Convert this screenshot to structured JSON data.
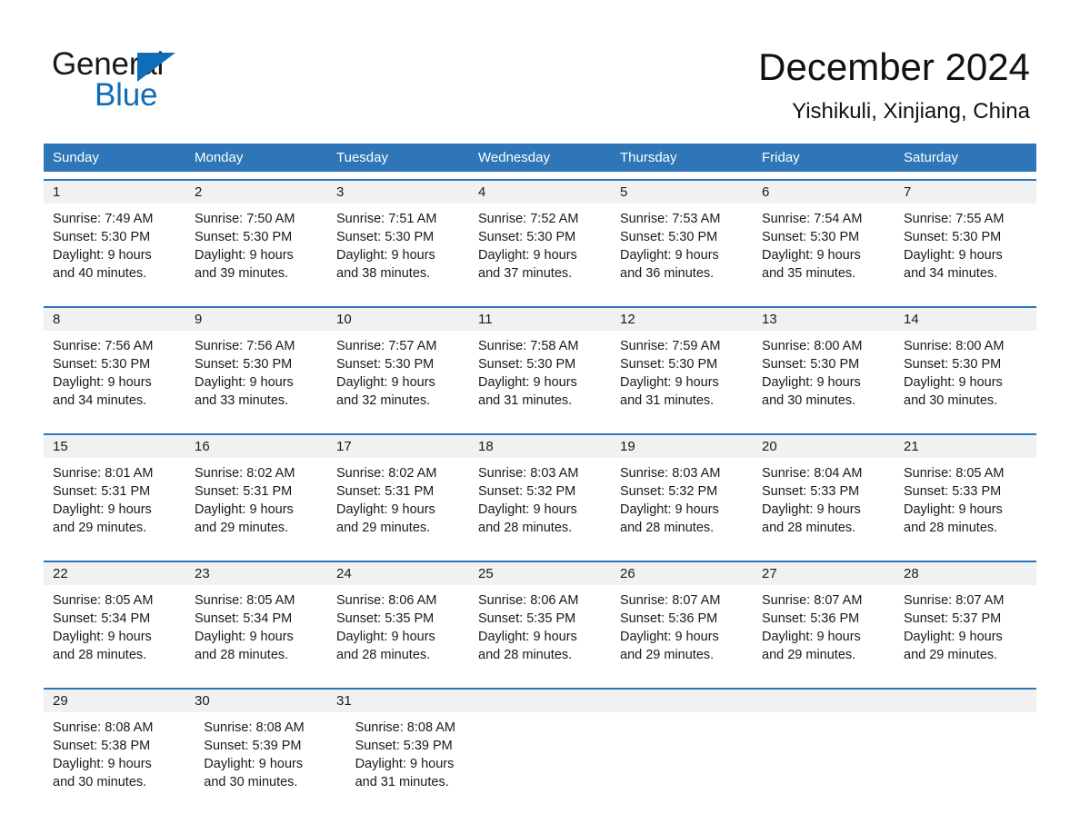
{
  "brand": {
    "name_part1": "General",
    "name_part2": "Blue",
    "triangle_icon": "triangle-icon",
    "accent_color": "#0f6cb6"
  },
  "header": {
    "title": "December 2024",
    "location": "Yishikuli, Xinjiang, China"
  },
  "colors": {
    "header_blue": "#2e76b8",
    "daynum_band": "#f1f1f1",
    "text": "#1a1a1a"
  },
  "weekdays": [
    "Sunday",
    "Monday",
    "Tuesday",
    "Wednesday",
    "Thursday",
    "Friday",
    "Saturday"
  ],
  "weeks": [
    {
      "days": [
        {
          "num": "1",
          "sunrise": "Sunrise: 7:49 AM",
          "sunset": "Sunset: 5:30 PM",
          "daylight1": "Daylight: 9 hours",
          "daylight2": "and 40 minutes."
        },
        {
          "num": "2",
          "sunrise": "Sunrise: 7:50 AM",
          "sunset": "Sunset: 5:30 PM",
          "daylight1": "Daylight: 9 hours",
          "daylight2": "and 39 minutes."
        },
        {
          "num": "3",
          "sunrise": "Sunrise: 7:51 AM",
          "sunset": "Sunset: 5:30 PM",
          "daylight1": "Daylight: 9 hours",
          "daylight2": "and 38 minutes."
        },
        {
          "num": "4",
          "sunrise": "Sunrise: 7:52 AM",
          "sunset": "Sunset: 5:30 PM",
          "daylight1": "Daylight: 9 hours",
          "daylight2": "and 37 minutes."
        },
        {
          "num": "5",
          "sunrise": "Sunrise: 7:53 AM",
          "sunset": "Sunset: 5:30 PM",
          "daylight1": "Daylight: 9 hours",
          "daylight2": "and 36 minutes."
        },
        {
          "num": "6",
          "sunrise": "Sunrise: 7:54 AM",
          "sunset": "Sunset: 5:30 PM",
          "daylight1": "Daylight: 9 hours",
          "daylight2": "and 35 minutes."
        },
        {
          "num": "7",
          "sunrise": "Sunrise: 7:55 AM",
          "sunset": "Sunset: 5:30 PM",
          "daylight1": "Daylight: 9 hours",
          "daylight2": "and 34 minutes."
        }
      ]
    },
    {
      "days": [
        {
          "num": "8",
          "sunrise": "Sunrise: 7:56 AM",
          "sunset": "Sunset: 5:30 PM",
          "daylight1": "Daylight: 9 hours",
          "daylight2": "and 34 minutes."
        },
        {
          "num": "9",
          "sunrise": "Sunrise: 7:56 AM",
          "sunset": "Sunset: 5:30 PM",
          "daylight1": "Daylight: 9 hours",
          "daylight2": "and 33 minutes."
        },
        {
          "num": "10",
          "sunrise": "Sunrise: 7:57 AM",
          "sunset": "Sunset: 5:30 PM",
          "daylight1": "Daylight: 9 hours",
          "daylight2": "and 32 minutes."
        },
        {
          "num": "11",
          "sunrise": "Sunrise: 7:58 AM",
          "sunset": "Sunset: 5:30 PM",
          "daylight1": "Daylight: 9 hours",
          "daylight2": "and 31 minutes."
        },
        {
          "num": "12",
          "sunrise": "Sunrise: 7:59 AM",
          "sunset": "Sunset: 5:30 PM",
          "daylight1": "Daylight: 9 hours",
          "daylight2": "and 31 minutes."
        },
        {
          "num": "13",
          "sunrise": "Sunrise: 8:00 AM",
          "sunset": "Sunset: 5:30 PM",
          "daylight1": "Daylight: 9 hours",
          "daylight2": "and 30 minutes."
        },
        {
          "num": "14",
          "sunrise": "Sunrise: 8:00 AM",
          "sunset": "Sunset: 5:30 PM",
          "daylight1": "Daylight: 9 hours",
          "daylight2": "and 30 minutes."
        }
      ]
    },
    {
      "days": [
        {
          "num": "15",
          "sunrise": "Sunrise: 8:01 AM",
          "sunset": "Sunset: 5:31 PM",
          "daylight1": "Daylight: 9 hours",
          "daylight2": "and 29 minutes."
        },
        {
          "num": "16",
          "sunrise": "Sunrise: 8:02 AM",
          "sunset": "Sunset: 5:31 PM",
          "daylight1": "Daylight: 9 hours",
          "daylight2": "and 29 minutes."
        },
        {
          "num": "17",
          "sunrise": "Sunrise: 8:02 AM",
          "sunset": "Sunset: 5:31 PM",
          "daylight1": "Daylight: 9 hours",
          "daylight2": "and 29 minutes."
        },
        {
          "num": "18",
          "sunrise": "Sunrise: 8:03 AM",
          "sunset": "Sunset: 5:32 PM",
          "daylight1": "Daylight: 9 hours",
          "daylight2": "and 28 minutes."
        },
        {
          "num": "19",
          "sunrise": "Sunrise: 8:03 AM",
          "sunset": "Sunset: 5:32 PM",
          "daylight1": "Daylight: 9 hours",
          "daylight2": "and 28 minutes."
        },
        {
          "num": "20",
          "sunrise": "Sunrise: 8:04 AM",
          "sunset": "Sunset: 5:33 PM",
          "daylight1": "Daylight: 9 hours",
          "daylight2": "and 28 minutes."
        },
        {
          "num": "21",
          "sunrise": "Sunrise: 8:05 AM",
          "sunset": "Sunset: 5:33 PM",
          "daylight1": "Daylight: 9 hours",
          "daylight2": "and 28 minutes."
        }
      ]
    },
    {
      "days": [
        {
          "num": "22",
          "sunrise": "Sunrise: 8:05 AM",
          "sunset": "Sunset: 5:34 PM",
          "daylight1": "Daylight: 9 hours",
          "daylight2": "and 28 minutes."
        },
        {
          "num": "23",
          "sunrise": "Sunrise: 8:05 AM",
          "sunset": "Sunset: 5:34 PM",
          "daylight1": "Daylight: 9 hours",
          "daylight2": "and 28 minutes."
        },
        {
          "num": "24",
          "sunrise": "Sunrise: 8:06 AM",
          "sunset": "Sunset: 5:35 PM",
          "daylight1": "Daylight: 9 hours",
          "daylight2": "and 28 minutes."
        },
        {
          "num": "25",
          "sunrise": "Sunrise: 8:06 AM",
          "sunset": "Sunset: 5:35 PM",
          "daylight1": "Daylight: 9 hours",
          "daylight2": "and 28 minutes."
        },
        {
          "num": "26",
          "sunrise": "Sunrise: 8:07 AM",
          "sunset": "Sunset: 5:36 PM",
          "daylight1": "Daylight: 9 hours",
          "daylight2": "and 29 minutes."
        },
        {
          "num": "27",
          "sunrise": "Sunrise: 8:07 AM",
          "sunset": "Sunset: 5:36 PM",
          "daylight1": "Daylight: 9 hours",
          "daylight2": "and 29 minutes."
        },
        {
          "num": "28",
          "sunrise": "Sunrise: 8:07 AM",
          "sunset": "Sunset: 5:37 PM",
          "daylight1": "Daylight: 9 hours",
          "daylight2": "and 29 minutes."
        }
      ]
    },
    {
      "days": [
        {
          "num": "29",
          "sunrise": "Sunrise: 8:08 AM",
          "sunset": "Sunset: 5:38 PM",
          "daylight1": "Daylight: 9 hours",
          "daylight2": "and 30 minutes."
        },
        {
          "num": "30",
          "sunrise": "Sunrise: 8:08 AM",
          "sunset": "Sunset: 5:39 PM",
          "daylight1": "Daylight: 9 hours",
          "daylight2": "and 30 minutes."
        },
        {
          "num": "31",
          "sunrise": "Sunrise: 8:08 AM",
          "sunset": "Sunset: 5:39 PM",
          "daylight1": "Daylight: 9 hours",
          "daylight2": "and 31 minutes."
        },
        {
          "num": "",
          "sunrise": "",
          "sunset": "",
          "daylight1": "",
          "daylight2": ""
        },
        {
          "num": "",
          "sunrise": "",
          "sunset": "",
          "daylight1": "",
          "daylight2": ""
        },
        {
          "num": "",
          "sunrise": "",
          "sunset": "",
          "daylight1": "",
          "daylight2": ""
        },
        {
          "num": "",
          "sunrise": "",
          "sunset": "",
          "daylight1": "",
          "daylight2": ""
        }
      ]
    }
  ]
}
